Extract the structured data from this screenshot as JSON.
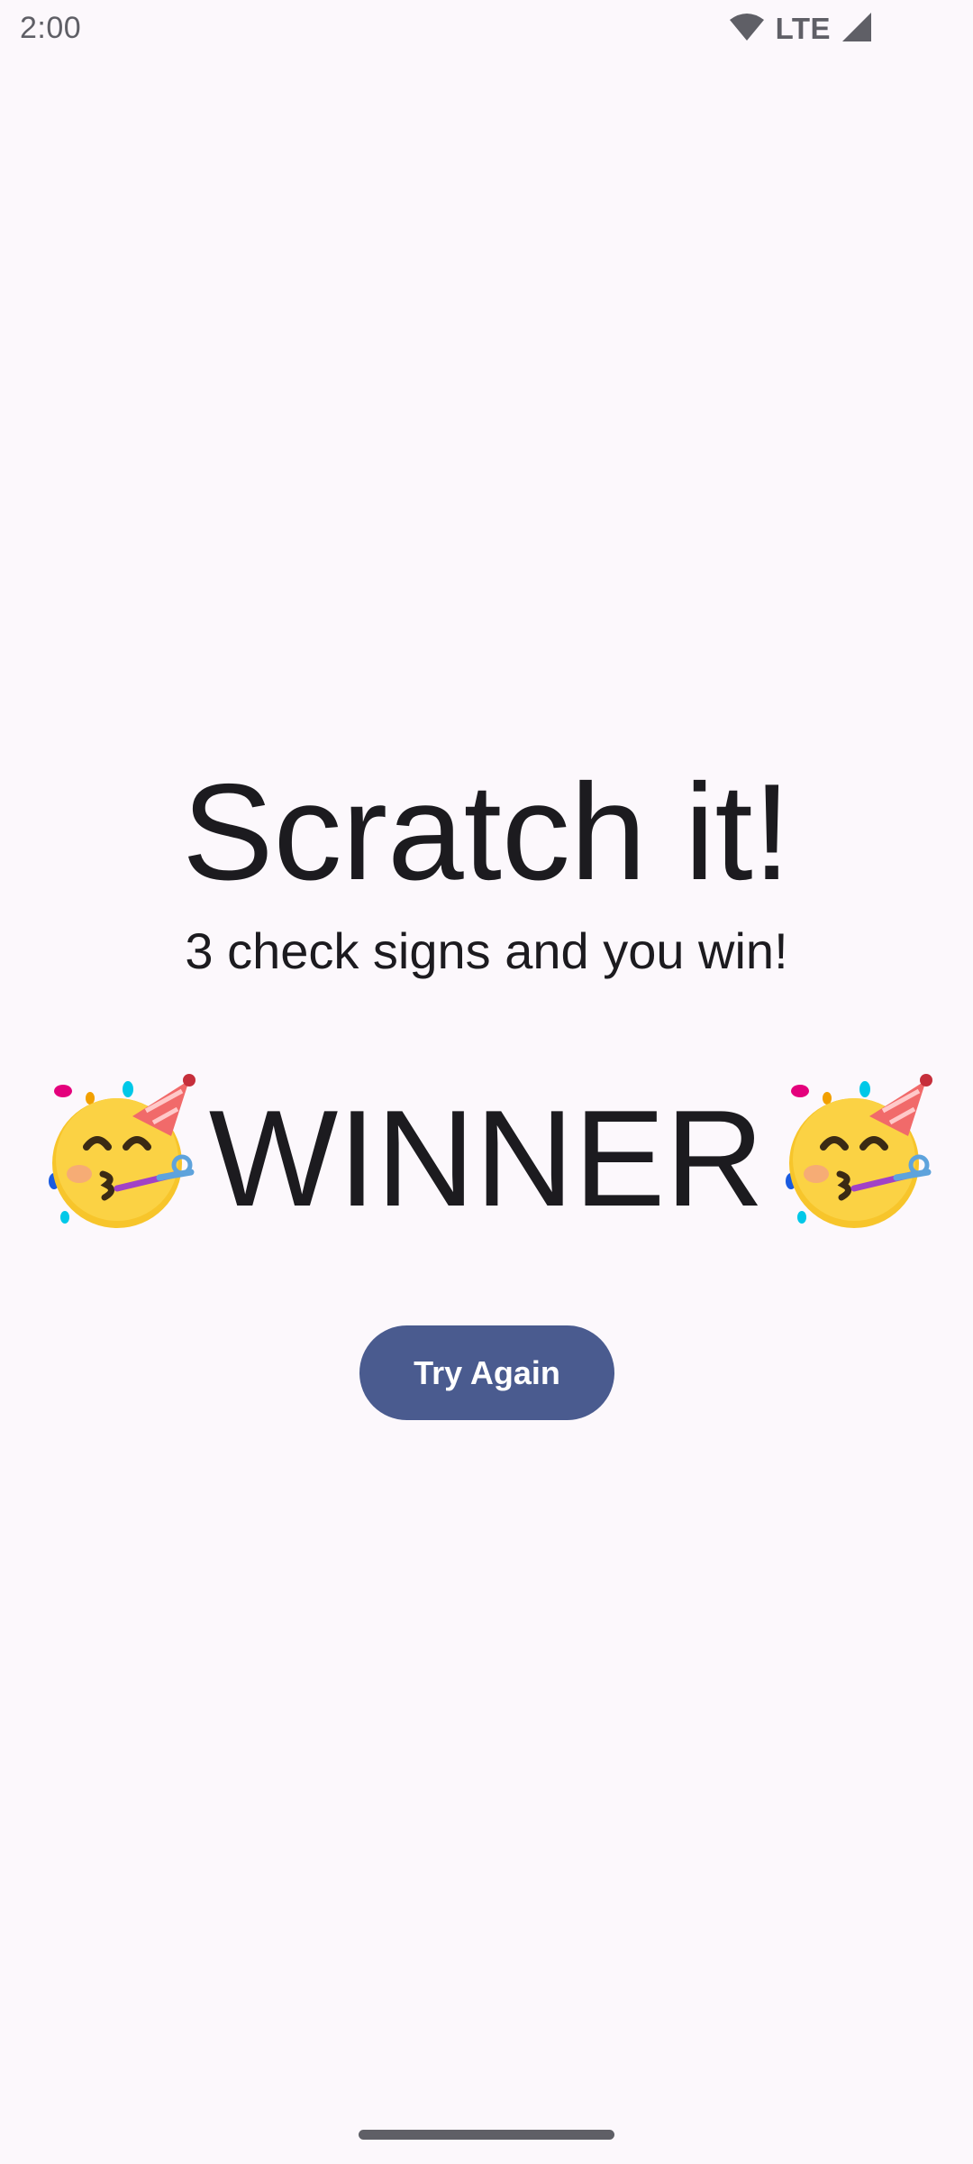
{
  "status_bar": {
    "time": "2:00",
    "network": "LTE",
    "icons": [
      "wifi-icon",
      "signal-icon"
    ],
    "icon_color": "#5f5f66"
  },
  "game": {
    "title": "Scratch it!",
    "subtitle": "3 check signs and you win!",
    "result": "WINNER",
    "result_icon": "party-face-icon"
  },
  "actions": {
    "try_again_label": "Try Again",
    "button_color": "#4a5b8f"
  },
  "colors": {
    "background": "#fcf8fc",
    "text": "#1c1b1f"
  }
}
